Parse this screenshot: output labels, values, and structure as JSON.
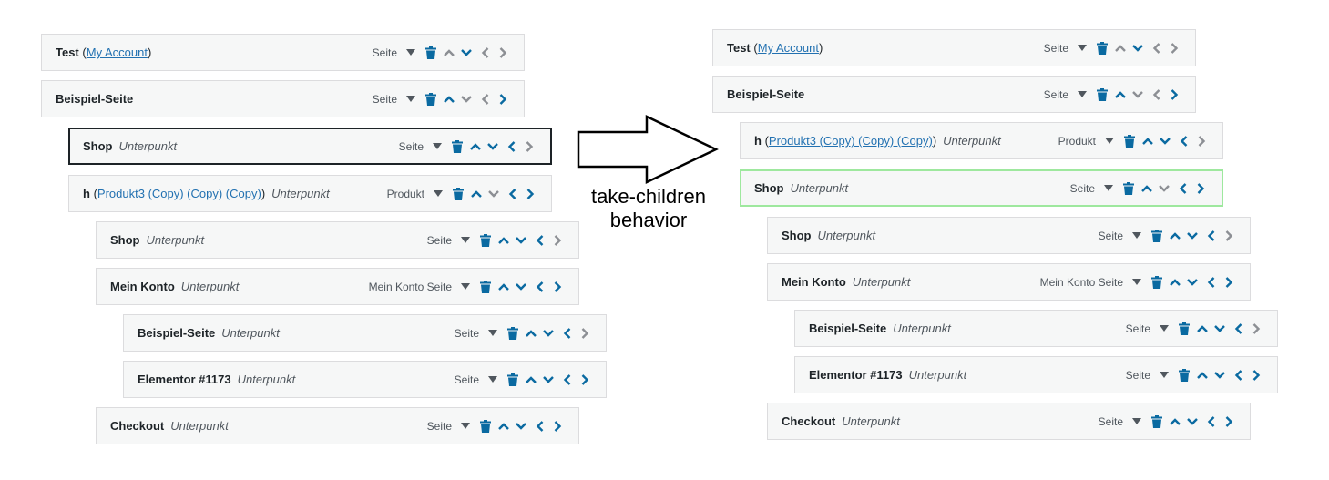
{
  "colors": {
    "row_background": "#f6f7f7",
    "row_border": "#dcdcde",
    "link": "#2271b1",
    "icon_active": "#0a6aa1",
    "icon_disabled": "#8c8f94",
    "selected_border": "#1d2327",
    "highlight_border": "#9ee89e"
  },
  "icons": {
    "dropdown": "triangle-down-icon",
    "delete": "trash-icon",
    "move_up": "chevron-up-icon",
    "move_down": "chevron-down-icon",
    "move_out": "chevron-left-icon",
    "move_in": "chevron-right-icon"
  },
  "transition_label": {
    "line1": "take-children",
    "line2": "behavior"
  },
  "before": {
    "items": [
      {
        "title": "Test",
        "link": "My Account",
        "sub": "",
        "type": "Seite",
        "up": false,
        "down": true,
        "left": false,
        "right": false
      },
      {
        "title": "Beispiel-Seite",
        "link": "",
        "sub": "",
        "type": "Seite",
        "up": true,
        "down": false,
        "left": false,
        "right": true
      },
      {
        "title": "Shop",
        "link": "",
        "sub": "Unterpunkt",
        "type": "Seite",
        "up": true,
        "down": true,
        "left": true,
        "right": false
      },
      {
        "title": "h",
        "link": "Produkt3 (Copy) (Copy) (Copy)",
        "sub": "Unterpunkt",
        "type": "Produkt",
        "up": true,
        "down": false,
        "left": true,
        "right": true
      },
      {
        "title": "Shop",
        "link": "",
        "sub": "Unterpunkt",
        "type": "Seite",
        "up": true,
        "down": true,
        "left": true,
        "right": false
      },
      {
        "title": "Mein Konto",
        "link": "",
        "sub": "Unterpunkt",
        "type": "Mein Konto Seite",
        "up": true,
        "down": true,
        "left": true,
        "right": true
      },
      {
        "title": "Beispiel-Seite",
        "link": "",
        "sub": "Unterpunkt",
        "type": "Seite",
        "up": true,
        "down": true,
        "left": true,
        "right": false
      },
      {
        "title": "Elementor #1173",
        "link": "",
        "sub": "Unterpunkt",
        "type": "Seite",
        "up": true,
        "down": true,
        "left": true,
        "right": true
      },
      {
        "title": "Checkout",
        "link": "",
        "sub": "Unterpunkt",
        "type": "Seite",
        "up": true,
        "down": true,
        "left": true,
        "right": true
      }
    ]
  },
  "after": {
    "items": [
      {
        "title": "Test",
        "link": "My Account",
        "sub": "",
        "type": "Seite",
        "up": false,
        "down": true,
        "left": false,
        "right": false
      },
      {
        "title": "Beispiel-Seite",
        "link": "",
        "sub": "",
        "type": "Seite",
        "up": true,
        "down": false,
        "left": false,
        "right": true
      },
      {
        "title": "h",
        "link": "Produkt3 (Copy) (Copy) (Copy)",
        "sub": "Unterpunkt",
        "type": "Produkt",
        "up": true,
        "down": true,
        "left": true,
        "right": false
      },
      {
        "title": "Shop",
        "link": "",
        "sub": "Unterpunkt",
        "type": "Seite",
        "up": true,
        "down": false,
        "left": true,
        "right": true
      },
      {
        "title": "Shop",
        "link": "",
        "sub": "Unterpunkt",
        "type": "Seite",
        "up": true,
        "down": true,
        "left": true,
        "right": false
      },
      {
        "title": "Mein Konto",
        "link": "",
        "sub": "Unterpunkt",
        "type": "Mein Konto Seite",
        "up": true,
        "down": true,
        "left": true,
        "right": true
      },
      {
        "title": "Beispiel-Seite",
        "link": "",
        "sub": "Unterpunkt",
        "type": "Seite",
        "up": true,
        "down": true,
        "left": true,
        "right": false
      },
      {
        "title": "Elementor #1173",
        "link": "",
        "sub": "Unterpunkt",
        "type": "Seite",
        "up": true,
        "down": true,
        "left": true,
        "right": true
      },
      {
        "title": "Checkout",
        "link": "",
        "sub": "Unterpunkt",
        "type": "Seite",
        "up": true,
        "down": true,
        "left": true,
        "right": true
      }
    ]
  }
}
